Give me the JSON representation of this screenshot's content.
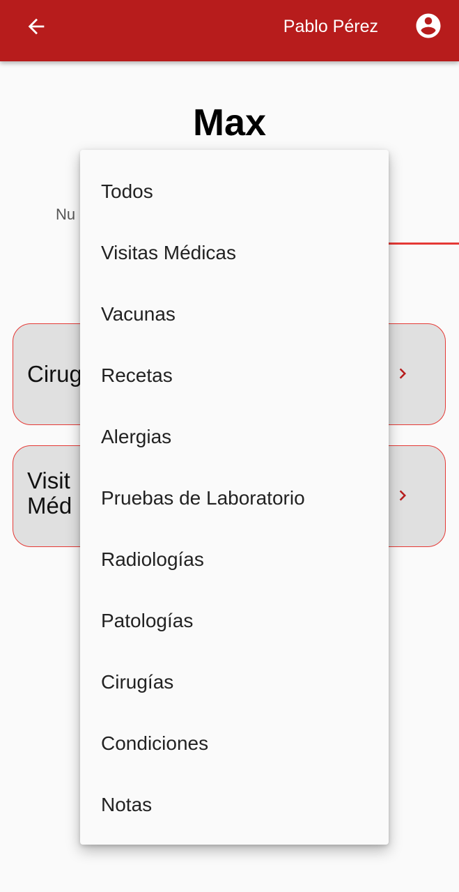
{
  "appbar": {
    "user_name": "Pablo Pérez",
    "background_color": "#b71c1c",
    "back_icon": "arrow-left-icon",
    "account_icon": "account-circle-icon"
  },
  "pet": {
    "name": "Max"
  },
  "tabs": {
    "partial_label": "Nu",
    "indicator_color": "#e53935"
  },
  "cards": [
    {
      "label": "Cirug",
      "chevron_icon": "chevron-right-icon"
    },
    {
      "label_line1": "Visit",
      "label_line2": "Méd",
      "chevron_icon": "chevron-right-icon"
    }
  ],
  "menu": {
    "items": [
      "Todos",
      "Visitas Médicas",
      "Vacunas",
      "Recetas",
      "Alergias",
      "Pruebas de Laboratorio",
      "Radiologías",
      "Patologías",
      "Cirugías",
      "Condiciones",
      "Notas"
    ]
  }
}
